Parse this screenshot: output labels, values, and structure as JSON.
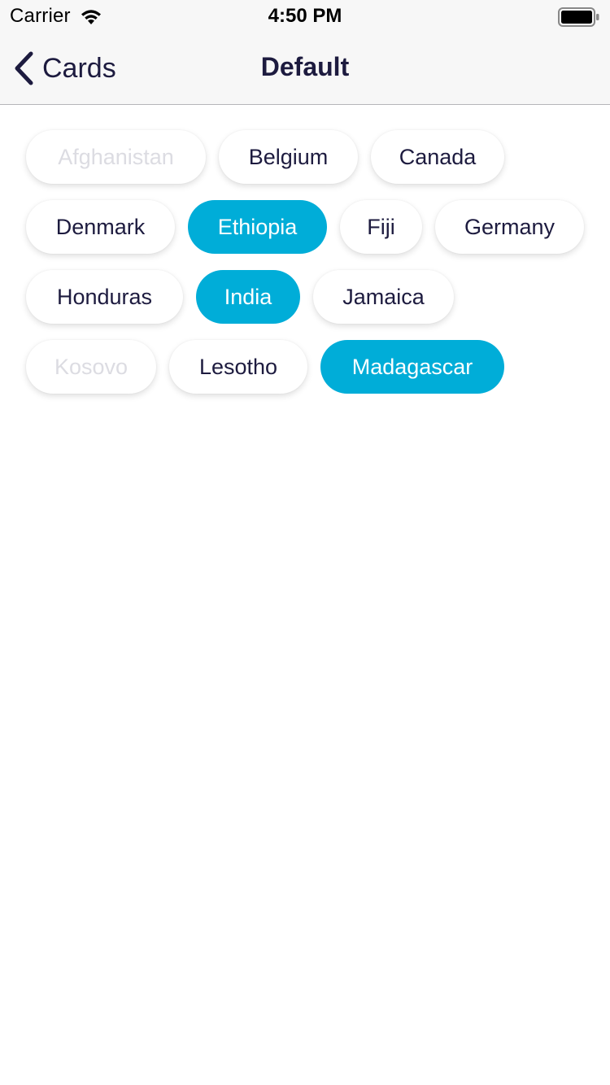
{
  "status_bar": {
    "carrier": "Carrier",
    "time": "4:50 PM",
    "icons": [
      "wifi-icon",
      "battery-icon"
    ]
  },
  "nav": {
    "back_label": "Cards",
    "title": "Default",
    "back_icon": "chevron-left-icon"
  },
  "colors": {
    "accent": "#00add8",
    "text": "#1d1b3f",
    "disabled_text": "#dcdce2",
    "chip_background": "#ffffff",
    "bar_background": "#f7f7f7"
  },
  "chips": [
    {
      "label": "Afghanistan",
      "state": "disabled"
    },
    {
      "label": "Belgium",
      "state": "normal"
    },
    {
      "label": "Canada",
      "state": "normal"
    },
    {
      "label": "Denmark",
      "state": "normal"
    },
    {
      "label": "Ethiopia",
      "state": "selected"
    },
    {
      "label": "Fiji",
      "state": "normal"
    },
    {
      "label": "Germany",
      "state": "normal"
    },
    {
      "label": "Honduras",
      "state": "normal"
    },
    {
      "label": "India",
      "state": "selected"
    },
    {
      "label": "Jamaica",
      "state": "normal"
    },
    {
      "label": "Kosovo",
      "state": "disabled"
    },
    {
      "label": "Lesotho",
      "state": "normal"
    },
    {
      "label": "Madagascar",
      "state": "selected"
    }
  ]
}
